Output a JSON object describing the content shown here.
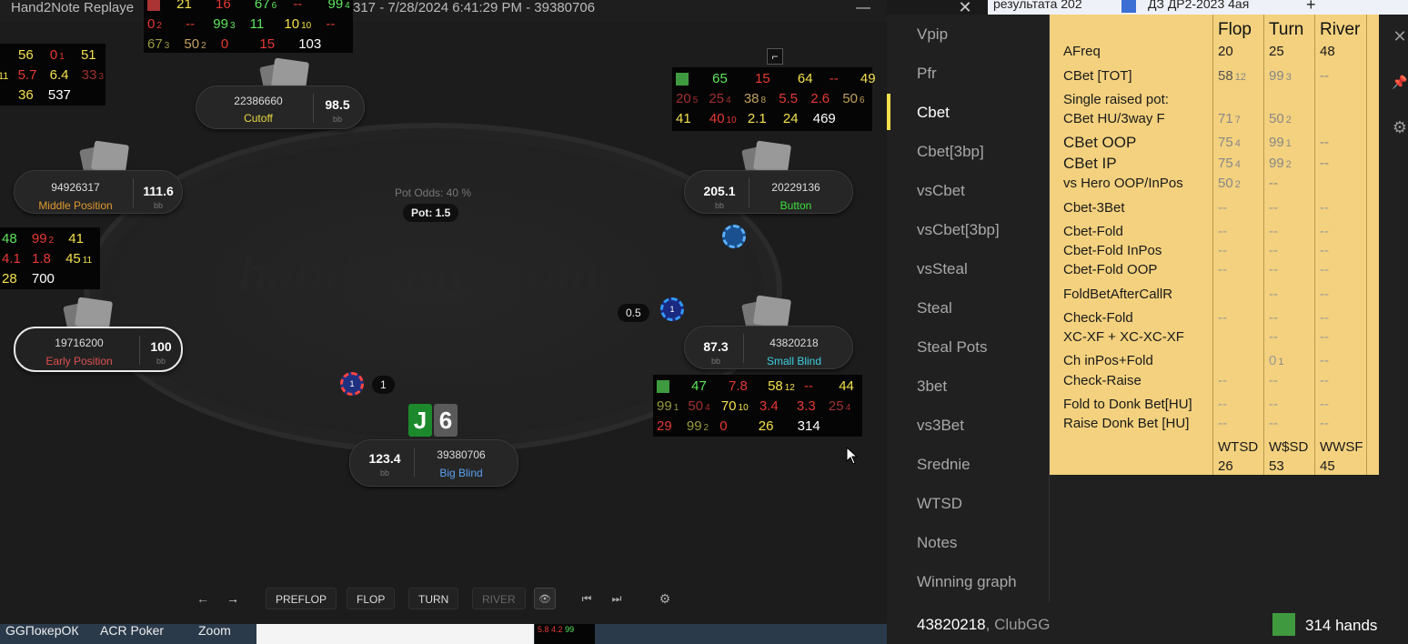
{
  "window": {
    "title_left": "Hand2Note Replaye",
    "title_right": "317 - 7/28/2024 6:41:29 PM - 39380706",
    "minimize": "—",
    "maximize": "☐",
    "close": "✕"
  },
  "table": {
    "watermark": "hand2note.com",
    "pot_odds": "Pot Odds: 40 %",
    "pot": "Pot: 1.5",
    "seats": {
      "cutoff": {
        "player": "22386660",
        "position": "Cutoff",
        "stack": "98.5",
        "unit": "bb"
      },
      "middle": {
        "player": "94926317",
        "position": "Middle Position",
        "stack": "111.6",
        "unit": "bb"
      },
      "early": {
        "player": "19716200",
        "position": "Early Position",
        "stack": "100",
        "unit": "bb"
      },
      "button": {
        "player": "20229136",
        "position": "Button",
        "stack": "205.1",
        "unit": "bb"
      },
      "small_blind": {
        "player": "43820218",
        "position": "Small Blind",
        "stack": "87.3",
        "unit": "bb"
      },
      "big_blind": {
        "player": "39380706",
        "position": "Big Blind",
        "stack": "123.4",
        "unit": "bb"
      }
    },
    "bets": {
      "sb": "0.5",
      "bb": "1",
      "bb_chip": "1",
      "sb_chip": "1"
    },
    "hole_cards": [
      "J",
      "6"
    ],
    "hud_top": {
      "r1": [
        "21",
        "16",
        "67",
        "6",
        "--",
        "99",
        "4"
      ],
      "r2": [
        "0",
        "2",
        "--",
        "99",
        "3",
        "11",
        "10",
        "10",
        "--"
      ],
      "r3": [
        "67",
        "3",
        "50",
        "2",
        "0",
        "15",
        "103"
      ]
    },
    "hud_left1": {
      "r1": [
        "56",
        "0",
        "1",
        "51"
      ],
      "r2": [
        "11",
        "5.7",
        "6.4",
        "33",
        "3"
      ],
      "r3": [
        "36",
        "537"
      ]
    },
    "hud_left2": {
      "r1": [
        "48",
        "99",
        "2",
        "41"
      ],
      "r2": [
        "4.1",
        "1.8",
        "45",
        "11"
      ],
      "r3": [
        "28",
        "700"
      ]
    },
    "hud_button": {
      "r1": [
        "65",
        "15",
        "64",
        "--",
        "49"
      ],
      "r2": [
        "20",
        "5",
        "25",
        "4",
        "38",
        "8",
        "5.5",
        "2.6",
        "50",
        "6"
      ],
      "r3": [
        "41",
        "40",
        "10",
        "2.1",
        "24",
        "469"
      ]
    },
    "hud_sb": {
      "r1": [
        "47",
        "7.8",
        "58",
        "12",
        "--",
        "44"
      ],
      "r2": [
        "99",
        "1",
        "50",
        "4",
        "70",
        "10",
        "3.4",
        "3.3",
        "25",
        "4"
      ],
      "r3": [
        "29",
        "99",
        "2",
        "0",
        "26",
        "314"
      ]
    },
    "strip_nums": {
      "r1": "5.8",
      "r2": "4.2",
      "r3": "99"
    }
  },
  "toolbar": {
    "back": "←",
    "forward": "→",
    "preflop": "PREFLOP",
    "flop": "FLOP",
    "turn": "TURN",
    "river": "RIVER",
    "eye": "👁",
    "first": "⏮",
    "last": "⏭",
    "settings": "⚙"
  },
  "taskbar": {
    "items": [
      "GGПокерОК",
      "ACR Poker",
      "Zoom"
    ]
  },
  "browser": {
    "tab1": "результата 202",
    "tab2": "ДЗ ДР2-2023 4ая",
    "new_tab": "+"
  },
  "popup": {
    "menu": [
      "Vpip",
      "Pfr",
      "Cbet",
      "Cbet[3bp]",
      "vsCbet",
      "vsCbet[3bp]",
      "vsSteal",
      "Steal",
      "Steal Pots",
      "3bet",
      "vs3Bet",
      "Srednie",
      "WTSD",
      "Notes",
      "Winning graph"
    ],
    "selected": "Cbet",
    "headers": {
      "flop": "Flop",
      "turn": "Turn",
      "river": "River"
    },
    "rows": {
      "afreq": {
        "label": "AFreq",
        "flop": "20",
        "turn": "25",
        "river": "48"
      },
      "cbet_tot": {
        "label": "CBet [TOT]",
        "flop": "58",
        "flop_n": "12",
        "turn": "99",
        "turn_n": "3",
        "river": "--"
      },
      "srp": {
        "label": "Single raised pot:"
      },
      "cbet_hu": {
        "label": "CBet HU/3way F",
        "flop": "71",
        "flop_n": "7",
        "turn": "50",
        "turn_n": "2"
      },
      "cbet_oop": {
        "label": "CBet OOP",
        "flop": "75",
        "flop_n": "4",
        "turn": "99",
        "turn_n": "1",
        "river": "--"
      },
      "cbet_ip": {
        "label": "CBet IP",
        "flop": "75",
        "flop_n": "4",
        "turn": "99",
        "turn_n": "2",
        "river": "--"
      },
      "vs_hero": {
        "label": "vs Hero OOP/InPos",
        "flop": "50",
        "flop_n": "2",
        "turn": "--"
      },
      "cbet_3bet": {
        "label": "Cbet-3Bet",
        "flop": "--",
        "turn": "--",
        "river": "--"
      },
      "cbet_fold": {
        "label": "Cbet-Fold",
        "flop": "--",
        "turn": "--",
        "river": "--"
      },
      "cbet_fold_inpos": {
        "label": "Cbet-Fold InPos",
        "flop": "--",
        "turn": "--",
        "river": "--"
      },
      "cbet_fold_oop": {
        "label": "Cbet-Fold OOP",
        "flop": "--",
        "turn": "--",
        "river": "--"
      },
      "foldbet": {
        "label": "FoldBetAfterCallR",
        "turn": "--",
        "river": "--"
      },
      "check_fold": {
        "label": "Check-Fold",
        "flop": "--",
        "turn": "--",
        "river": "--"
      },
      "xcxf": {
        "label": "XC-XF + XC-XC-XF",
        "turn": "--",
        "river": "--"
      },
      "ch_inpos": {
        "label": "Ch inPos+Fold",
        "turn": "0",
        "turn_n": "1",
        "river": "--"
      },
      "check_raise": {
        "label": "Check-Raise",
        "flop": "--",
        "turn": "--",
        "river": "--"
      },
      "fold_donk": {
        "label": "Fold to Donk Bet[HU]",
        "flop": "--",
        "turn": "--",
        "river": "--"
      },
      "raise_donk": {
        "label": "Raise Donk Bet [HU]",
        "flop": "--",
        "turn": "--",
        "river": "--"
      }
    },
    "bottom_headers": {
      "wtsd": "WTSD",
      "wsd": "W$SD",
      "wwsf": "WWSF"
    },
    "bottom_values": {
      "wtsd": "26",
      "wsd": "53",
      "wwsf": "45"
    },
    "footer_player": "43820218",
    "footer_club": ", ClubGG",
    "footer_hands": "314 hands",
    "close": "✕",
    "pin": "📌",
    "gear": "⚙"
  },
  "colors": {
    "accent": "#f4e04d",
    "panel": "#f3d17e",
    "green": "#3f9a3f"
  }
}
